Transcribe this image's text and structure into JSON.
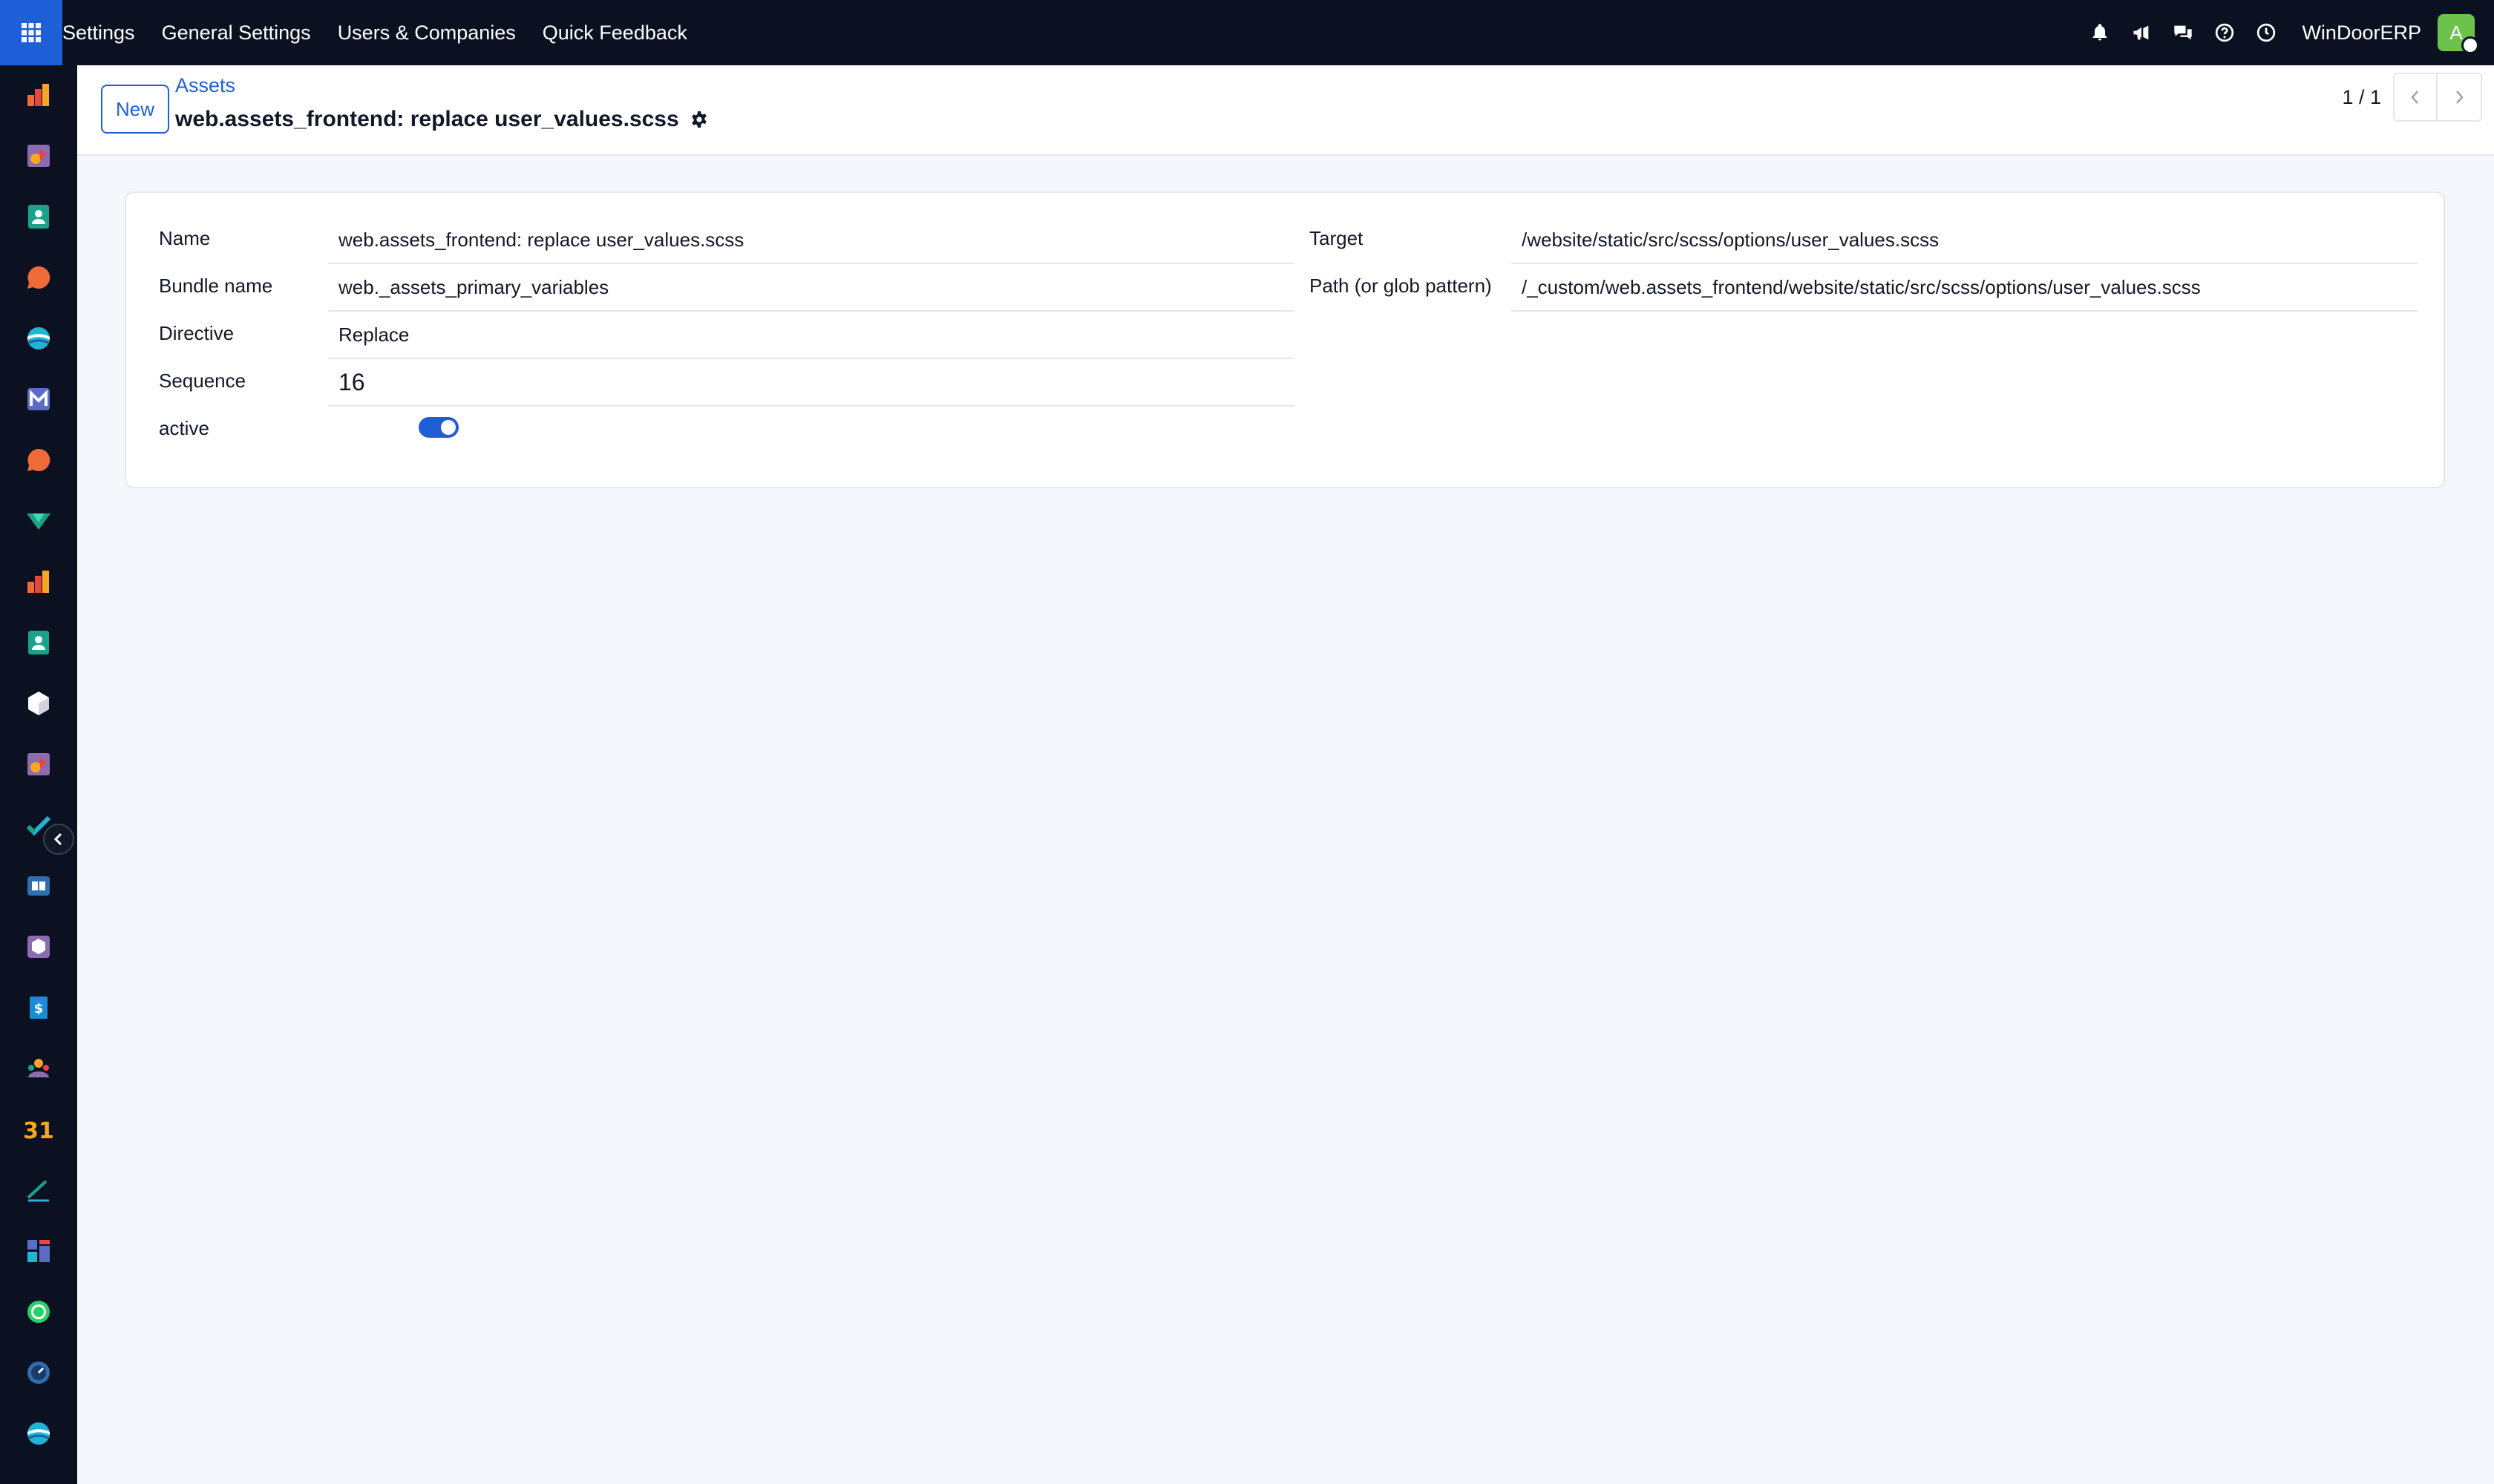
{
  "navbar": {
    "menu": [
      "Settings",
      "General Settings",
      "Users & Companies",
      "Quick Feedback"
    ],
    "company": "WinDoorERP",
    "avatar_letter": "A",
    "icons": [
      "bell-icon",
      "megaphone-icon",
      "chat-icon",
      "help-icon",
      "clock-icon"
    ]
  },
  "sidebar": {
    "apps": [
      "dashboards-icon",
      "knowledge-icon",
      "contacts-icon",
      "discuss-icon",
      "website-icon",
      "email-marketing-icon",
      "livechat-icon",
      "project-icon",
      "reports-icon",
      "employees-icon",
      "inventory-icon",
      "studio-icon",
      "tasks-icon",
      "documents-icon",
      "packages-icon",
      "invoicing-icon",
      "team-icon",
      "calendar-icon",
      "sign-icon",
      "spreadsheet-icon",
      "whatsapp-icon",
      "timesheet-icon",
      "website-builder-icon"
    ]
  },
  "control_panel": {
    "new_label": "New",
    "breadcrumb": "Assets",
    "title": "web.assets_frontend: replace user_values.scss",
    "pager": "1 / 1"
  },
  "form": {
    "name": {
      "label": "Name",
      "value": "web.assets_frontend: replace user_values.scss"
    },
    "bundle": {
      "label": "Bundle name",
      "value": "web._assets_primary_variables"
    },
    "directive": {
      "label": "Directive",
      "value": "Replace"
    },
    "sequence": {
      "label": "Sequence",
      "value": "16"
    },
    "active": {
      "label": "active",
      "value": true
    },
    "target": {
      "label": "Target",
      "value": "/website/static/src/scss/options/user_values.scss"
    },
    "path": {
      "label": "Path (or glob pattern)",
      "value": "/_custom/web.assets_frontend/website/static/src/scss/options/user_values.scss"
    }
  },
  "colors": {
    "navbar_bg": "#0b1120",
    "accent": "#1e5fd8",
    "page_bg": "#f4f7fb",
    "avatar": "#6cc24a"
  }
}
